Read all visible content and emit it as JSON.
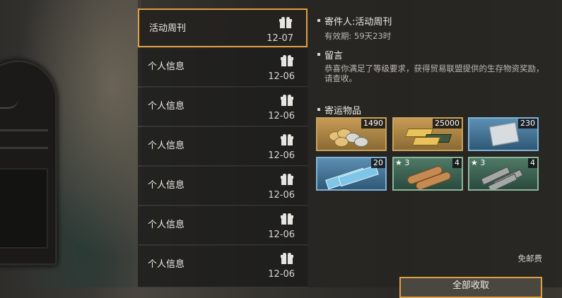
{
  "mail_list": [
    {
      "title": "活动周刊",
      "date": "12-07",
      "selected": true
    },
    {
      "title": "个人信息",
      "date": "12-06",
      "selected": false
    },
    {
      "title": "个人信息",
      "date": "12-06",
      "selected": false
    },
    {
      "title": "个人信息",
      "date": "12-06",
      "selected": false
    },
    {
      "title": "个人信息",
      "date": "12-06",
      "selected": false
    },
    {
      "title": "个人信息",
      "date": "12-06",
      "selected": false
    },
    {
      "title": "个人信息",
      "date": "12-06",
      "selected": false
    }
  ],
  "detail": {
    "sender": "寄件人:活动周刊",
    "validity": "有效期: 59天23时",
    "message_heading": "留言",
    "message_body": "恭喜你满足了等级要求，获得贸易联盟提供的生存物资奖励，请查收。",
    "items_heading": "寄运物品",
    "items": [
      {
        "qty": "1490",
        "stars": "",
        "rarity": "gold",
        "icon": "coins-icon"
      },
      {
        "qty": "25000",
        "stars": "",
        "rarity": "gold",
        "icon": "gold-bars-icon"
      },
      {
        "qty": "230",
        "stars": "",
        "rarity": "blue",
        "icon": "supply-bag-icon"
      },
      {
        "qty": "20",
        "stars": "",
        "rarity": "blue",
        "icon": "planks-icon"
      },
      {
        "qty": "4",
        "stars": "★ 3",
        "rarity": "green",
        "icon": "fabric-rolls-icon"
      },
      {
        "qty": "4",
        "stars": "★ 3",
        "rarity": "green",
        "icon": "pipes-icon"
      }
    ],
    "postage": "免邮费",
    "claim_label": "全部收取"
  },
  "colors": {
    "accent": "#e0a044",
    "gold": "#c9a25a",
    "blue": "#7fb4d6",
    "green": "#8bb79c"
  }
}
